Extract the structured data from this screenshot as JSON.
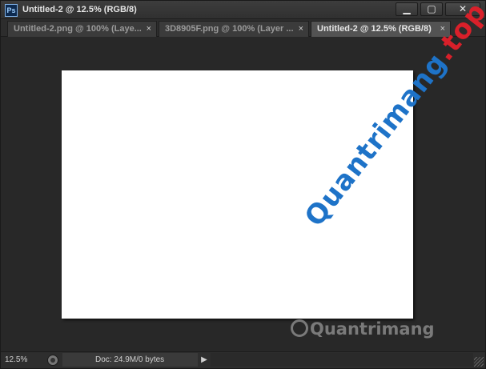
{
  "window": {
    "app_icon": "Ps",
    "title": "Untitled-2 @ 12.5% (RGB/8)",
    "controls": {
      "minimize": "minimize-icon",
      "maximize": "maximize-icon",
      "close": "close-icon"
    }
  },
  "tabs": [
    {
      "label": "Untitled-2.png @ 100% (Laye...",
      "close": "×",
      "active": false
    },
    {
      "label": "3D8905F.png @ 100% (Layer ...",
      "close": "×",
      "active": false
    },
    {
      "label": "Untitled-2 @ 12.5% (RGB/8)",
      "close": "×",
      "active": true
    }
  ],
  "status": {
    "zoom": "12.5%",
    "doc_info": "Doc: 24.9M/0 bytes"
  },
  "watermark": {
    "main_brand": "Quantrimang",
    "main_tld": "top",
    "sub": "Quantrimang"
  },
  "colors": {
    "canvas": "#ffffff",
    "workspace": "#282828",
    "brand_blue": "#1e73c8",
    "brand_red": "#d9202a"
  }
}
